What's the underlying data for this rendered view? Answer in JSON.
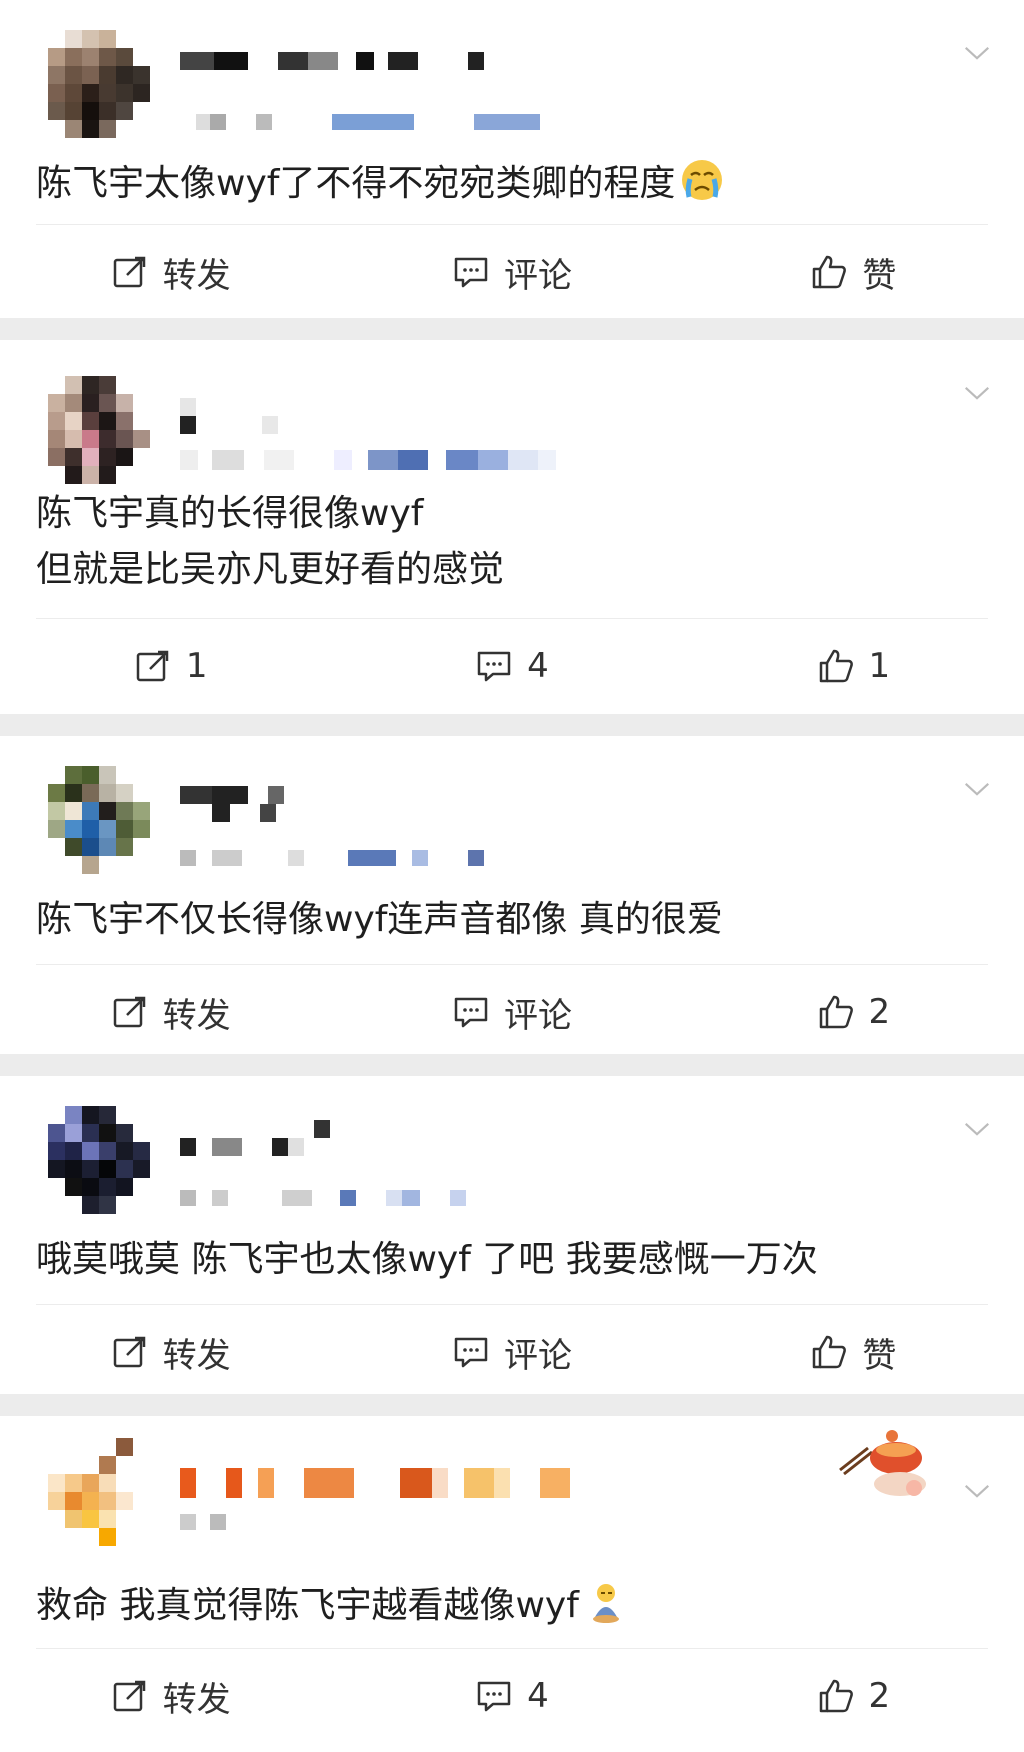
{
  "colors": {
    "page_bg": "#ececec",
    "card_bg": "#ffffff",
    "text": "#1f1f1f",
    "icon": "#333333"
  },
  "icons": {
    "repost": "share-box-icon",
    "comment": "comment-bubble-icon",
    "like": "thumbs-up-icon",
    "menu": "chevron-down-icon"
  },
  "posts": [
    {
      "lines": [
        "陈飞宇太像wyf了不得不宛宛类卿的程度"
      ],
      "trailing_emoji": "crying-face-emoji",
      "actions": {
        "repost": "转发",
        "comment": "评论",
        "like": "赞"
      }
    },
    {
      "lines": [
        "陈飞宇真的长得很像wyf",
        "但就是比吴亦凡更好看的感觉"
      ],
      "actions": {
        "repost": "1",
        "comment": "4",
        "like": "1"
      }
    },
    {
      "lines": [
        "陈飞宇不仅长得像wyf连声音都像 真的很爱"
      ],
      "actions": {
        "repost": "转发",
        "comment": "评论",
        "like": "2"
      }
    },
    {
      "lines": [
        "哦莫哦莫 陈飞宇也太像wyf 了吧 我要感慨一万次"
      ],
      "actions": {
        "repost": "转发",
        "comment": "评论",
        "like": "赞"
      }
    },
    {
      "lines": [
        "救命 我真觉得陈飞宇越看越像wyf"
      ],
      "trailing_emoji": "sitting-figure-emoji",
      "actions": {
        "repost": "转发",
        "comment": "4",
        "like": "2"
      }
    }
  ]
}
